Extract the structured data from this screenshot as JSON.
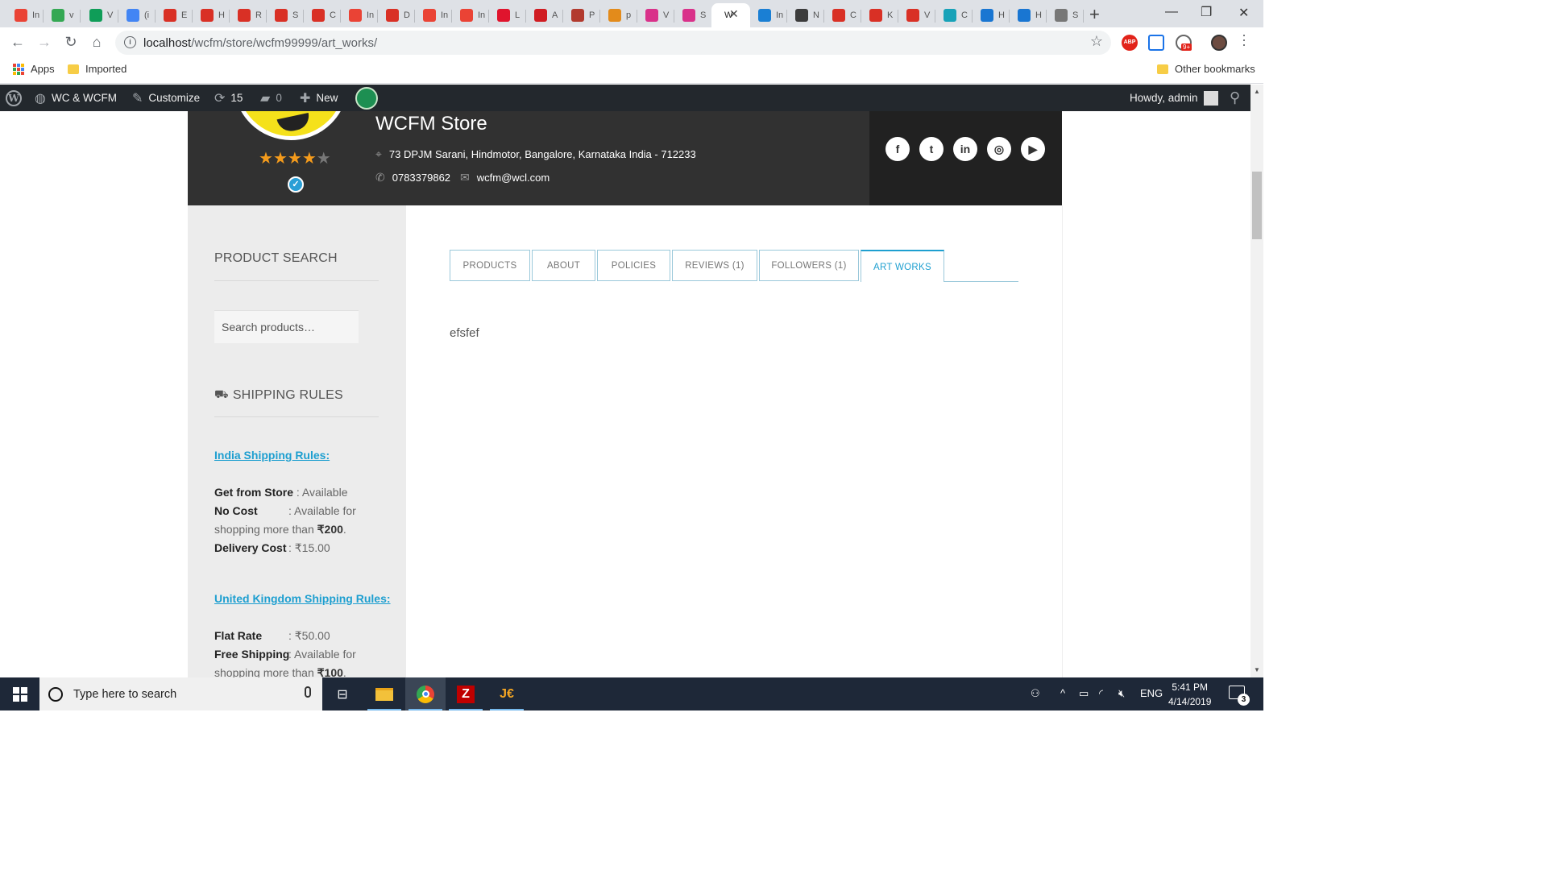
{
  "browser": {
    "tabs": [
      {
        "label": "In",
        "color": "#ea4335"
      },
      {
        "label": "v",
        "color": "#34a853"
      },
      {
        "label": "V",
        "color": "#0f9d58"
      },
      {
        "label": "(i",
        "color": "#4285f4"
      },
      {
        "label": "E",
        "color": "#d93025"
      },
      {
        "label": "H",
        "color": "#d93025"
      },
      {
        "label": "R",
        "color": "#d93025"
      },
      {
        "label": "S",
        "color": "#d93025"
      },
      {
        "label": "C",
        "color": "#d93025"
      },
      {
        "label": "In",
        "color": "#ea4335"
      },
      {
        "label": "D",
        "color": "#d93025"
      },
      {
        "label": "In",
        "color": "#ea4335"
      },
      {
        "label": "In",
        "color": "#ea4335"
      },
      {
        "label": "L",
        "color": "#e0142d"
      },
      {
        "label": "A",
        "color": "#d01c22"
      },
      {
        "label": "P",
        "color": "#b23a2e"
      },
      {
        "label": "p",
        "color": "#e38b1b"
      },
      {
        "label": "V",
        "color": "#d9318a"
      },
      {
        "label": "S",
        "color": "#d9318a"
      },
      {
        "label": "W",
        "color": "#ffffff"
      },
      {
        "label": "In",
        "color": "#1a7fd4"
      },
      {
        "label": "N",
        "color": "#3c3c3c"
      },
      {
        "label": "C",
        "color": "#d93025"
      },
      {
        "label": "K",
        "color": "#d93025"
      },
      {
        "label": "V",
        "color": "#d93025"
      },
      {
        "label": "C",
        "color": "#17a2b8"
      },
      {
        "label": "H",
        "color": "#1976d2"
      },
      {
        "label": "H",
        "color": "#1976d2"
      },
      {
        "label": "S",
        "color": "#777777"
      }
    ],
    "active_tab_index": 19,
    "url_host": "localhost",
    "url_path": "/wcfm/store/wcfm99999/art_works/",
    "abp_label": "ABP",
    "ext_badge": "9+",
    "bookmarks": {
      "apps": "Apps",
      "imported": "Imported",
      "other": "Other bookmarks"
    }
  },
  "wpbar": {
    "site_name": "WC & WCFM",
    "customize": "Customize",
    "updates_count": "15",
    "comments_count": "0",
    "new_label": "New",
    "greeting": "Howdy, admin"
  },
  "store": {
    "name": "WCFM Store",
    "address": "73 DPJM Sarani, Hindmotor, Bangalore, Karnataka India - 712233",
    "phone": "0783379862",
    "email": "wcfm@wcl.com",
    "rating": 4,
    "rating_max": 5,
    "social": [
      {
        "name": "facebook",
        "glyph": "f"
      },
      {
        "name": "twitter",
        "glyph": "t"
      },
      {
        "name": "linkedin",
        "glyph": "in"
      },
      {
        "name": "instagram",
        "glyph": "◎"
      },
      {
        "name": "youtube",
        "glyph": "▶"
      }
    ]
  },
  "sidebar": {
    "product_search_title": "PRODUCT SEARCH",
    "search_placeholder": "Search products…",
    "shipping_title": "SHIPPING RULES",
    "india": {
      "heading": "India Shipping Rules:",
      "rows": [
        {
          "label": "Get from Store",
          "value": ": Available"
        },
        {
          "label": "No Cost",
          "value": ": Available for"
        },
        {
          "label": "Delivery Cost",
          "value": ": ₹15.00"
        }
      ],
      "no_cost_cont_text": "shopping more than ",
      "no_cost_cont_amount": "₹200",
      "no_cost_cont_end": "."
    },
    "uk": {
      "heading": "United Kingdom Shipping Rules:",
      "rows": [
        {
          "label": "Flat Rate",
          "value": ": ₹50.00"
        },
        {
          "label": "Free Shipping",
          "value": ": Available for"
        }
      ],
      "free_cont_text": "shopping more than ",
      "free_cont_amount": "₹100",
      "free_cont_end": "."
    }
  },
  "tabs": [
    {
      "label": "PRODUCTS"
    },
    {
      "label": "ABOUT"
    },
    {
      "label": "POLICIES"
    },
    {
      "label": "REVIEWS (1)"
    },
    {
      "label": "FOLLOWERS (1)"
    },
    {
      "label": "ART WORKS"
    }
  ],
  "active_store_tab": 5,
  "art_works_content": "efsfef",
  "taskbar": {
    "search_placeholder": "Type here to search",
    "language": "ENG",
    "time": "5:41 PM",
    "date": "4/14/2019",
    "notifications": "3"
  }
}
